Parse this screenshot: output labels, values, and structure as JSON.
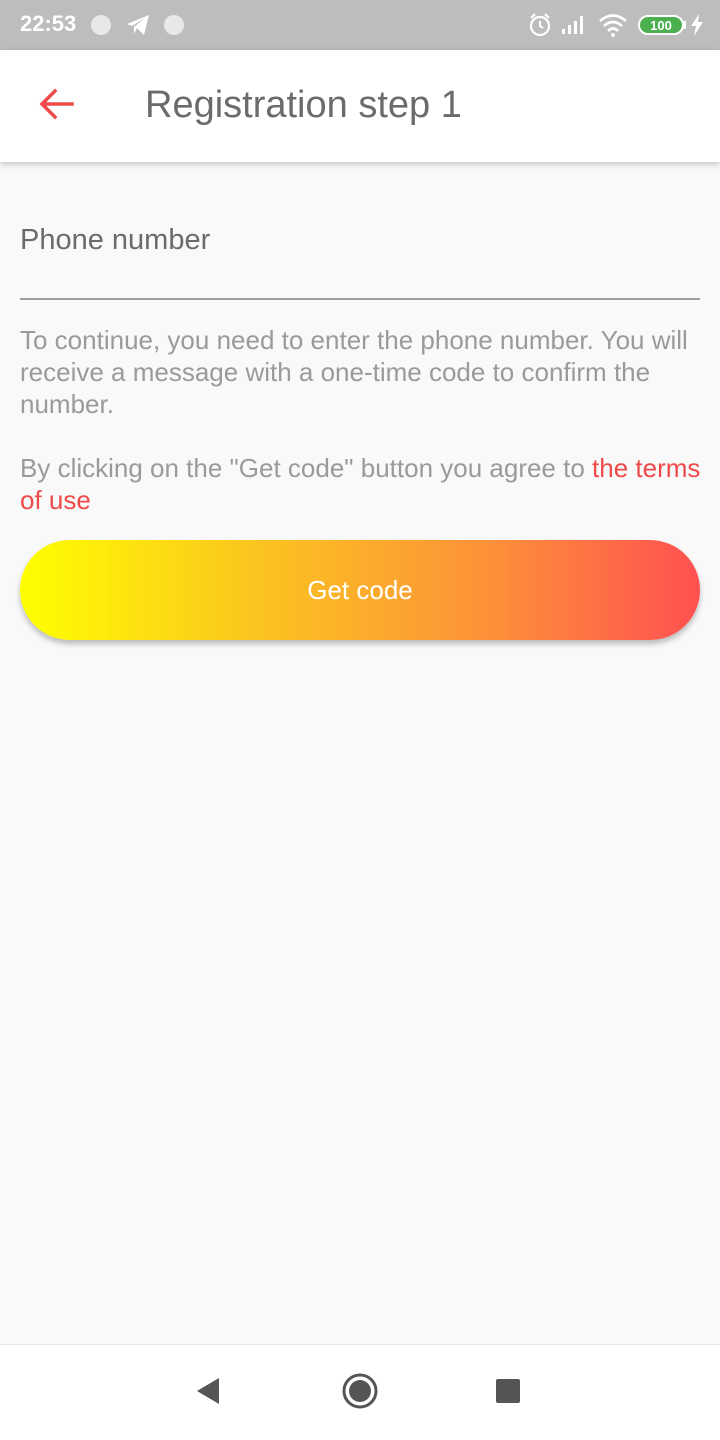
{
  "status_bar": {
    "time": "22:53",
    "battery": "100",
    "icons": [
      "circle-icon",
      "telegram-icon",
      "circle-icon",
      "alarm-icon",
      "signal-icon",
      "wifi-icon",
      "battery-icon",
      "charging-icon"
    ]
  },
  "app_bar": {
    "title": "Registration step 1",
    "back_icon": "arrow-left-icon",
    "accent_color": "#ef4a4a"
  },
  "form": {
    "phone_label": "Phone number",
    "help_text": "To continue, you need to enter the phone number. You will receive a message with a one-time code to confirm the number.",
    "terms_prefix": "By clicking on the \"Get code\" button you agree to ",
    "terms_link": "the terms of use",
    "button_label": "Get code",
    "button_gradient": [
      "#ffff00",
      "#fbc420",
      "#fd8f3a",
      "#ff5050"
    ]
  },
  "nav_bar": {
    "icons": [
      "back-triangle-icon",
      "home-circle-icon",
      "recents-square-icon"
    ]
  }
}
